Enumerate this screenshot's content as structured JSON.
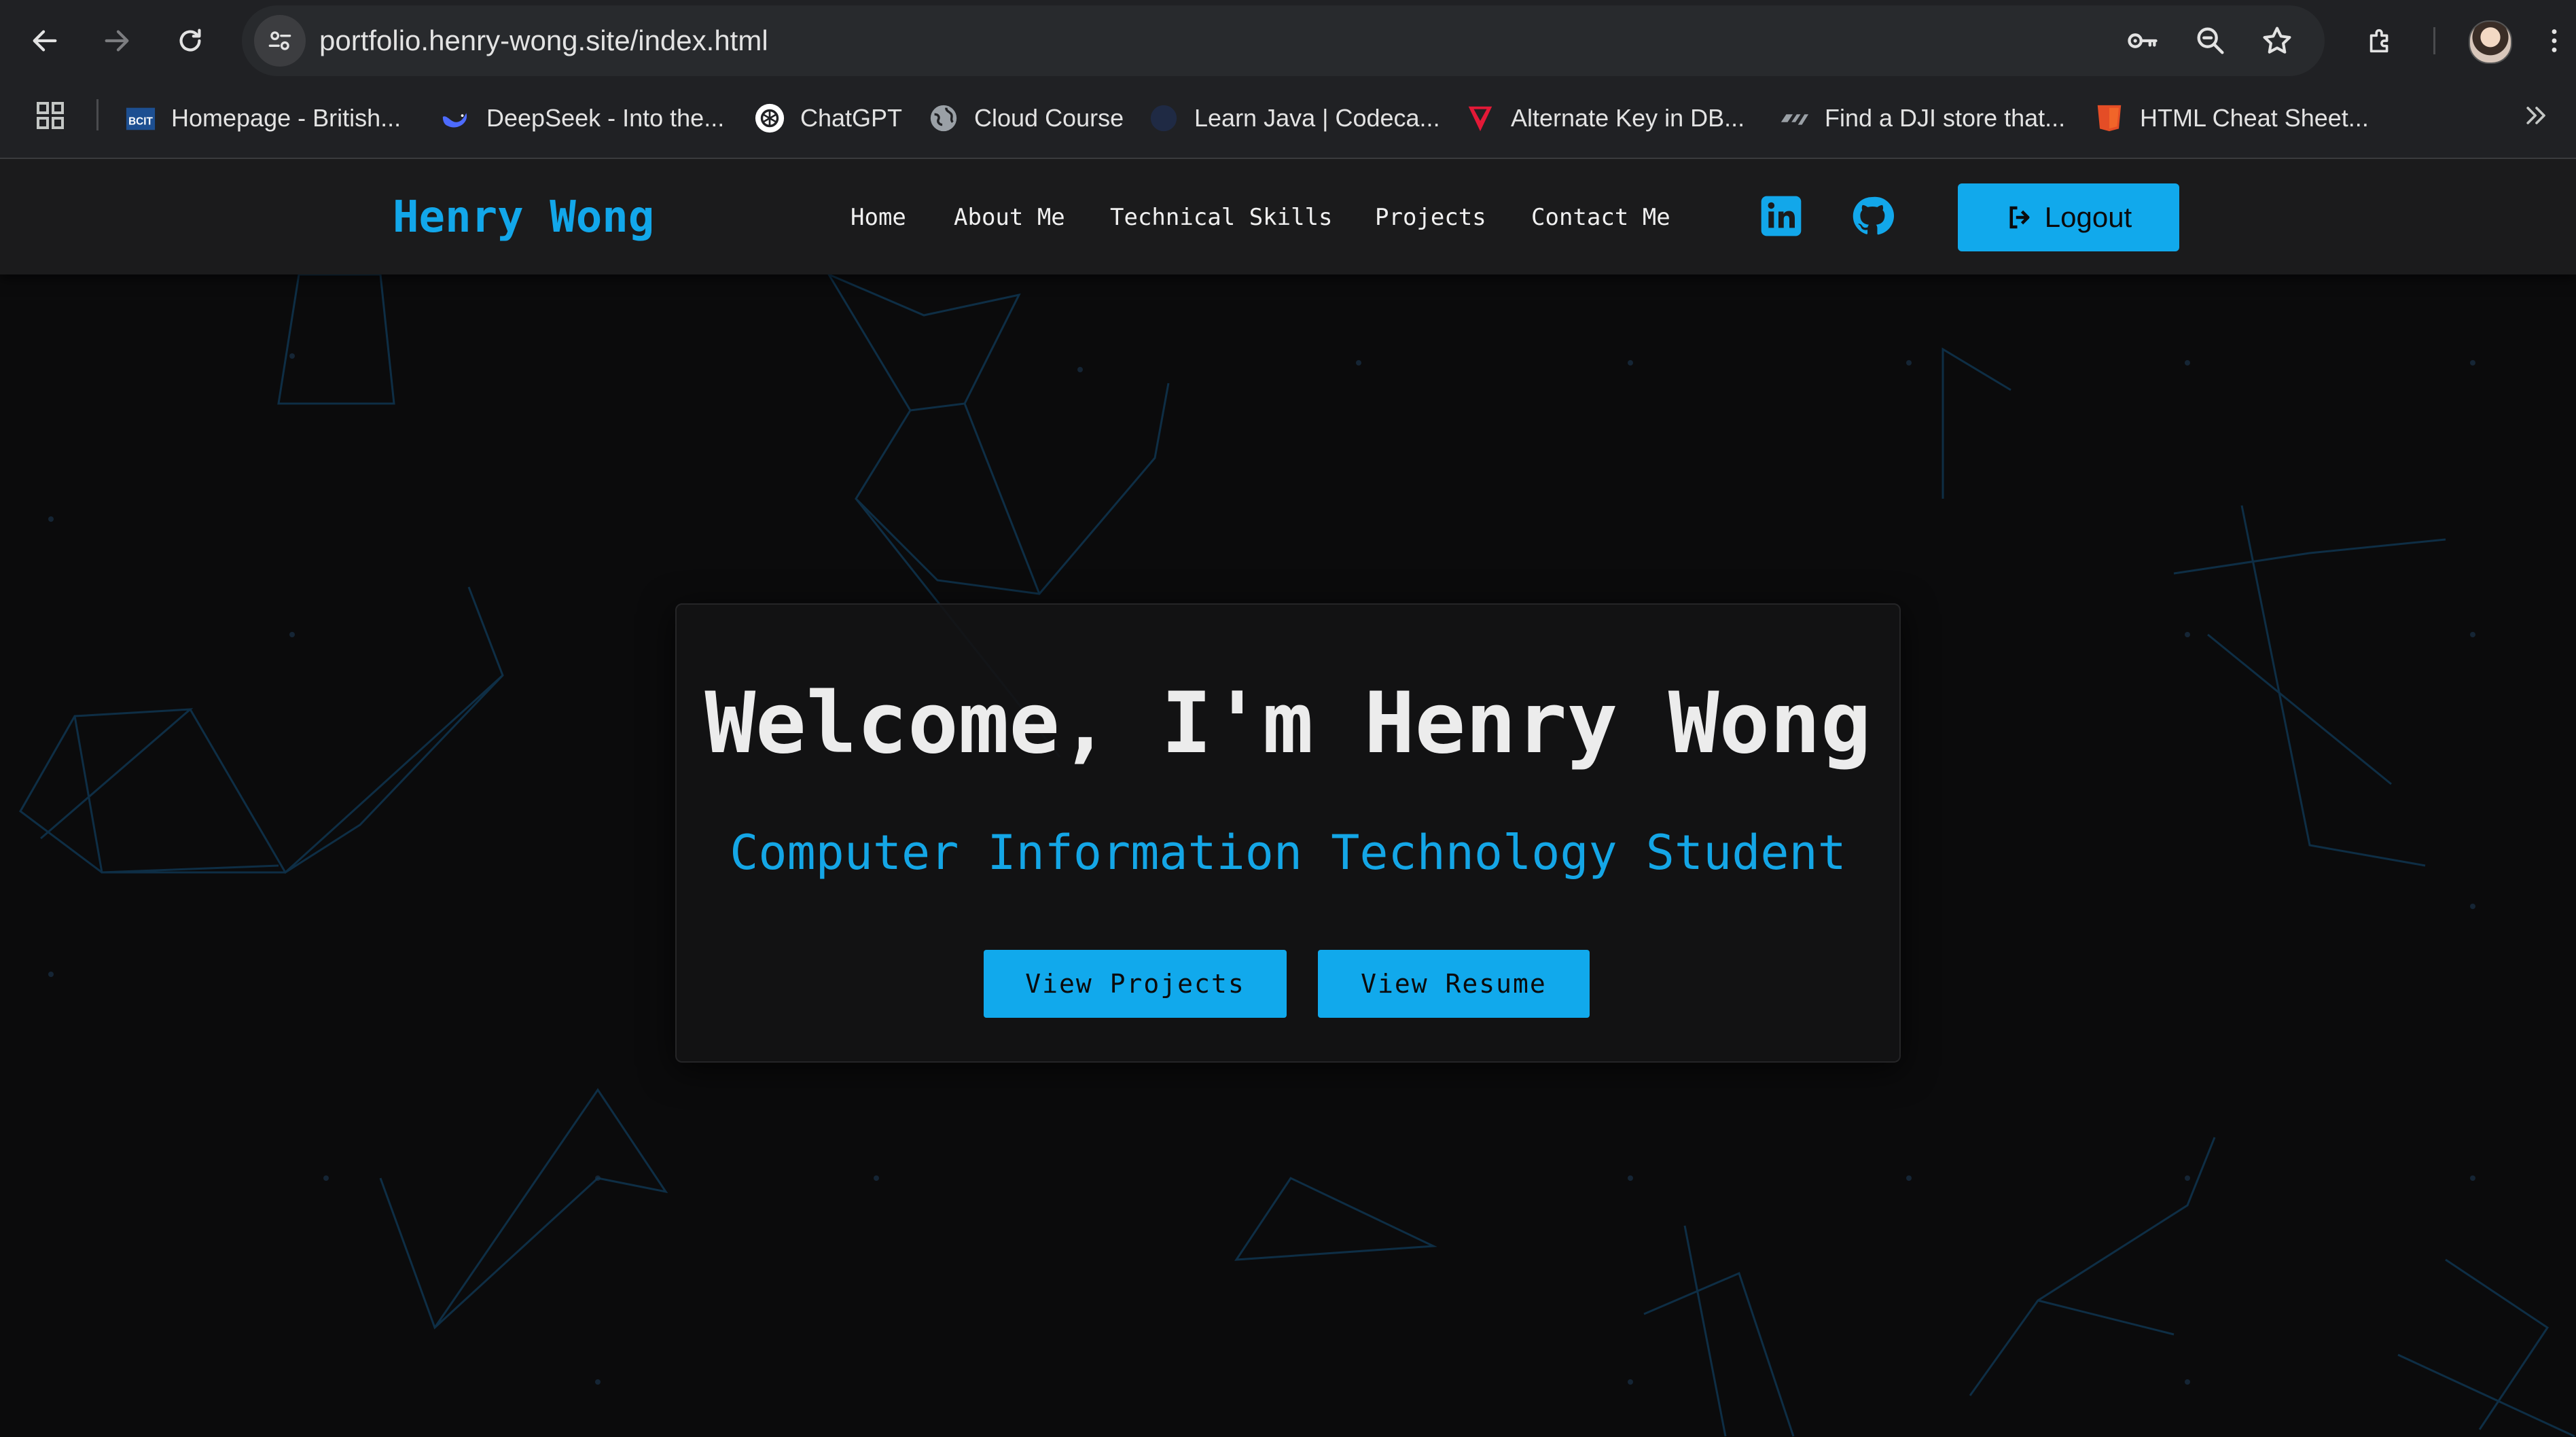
{
  "browser": {
    "url": "portfolio.henry-wong.site/index.html",
    "bookmarks": [
      {
        "label": "Homepage - British...",
        "icon": "bcit-icon"
      },
      {
        "label": "DeepSeek - Into the...",
        "icon": "deepseek-icon"
      },
      {
        "label": "ChatGPT",
        "icon": "chatgpt-icon"
      },
      {
        "label": "Cloud Course",
        "icon": "globe-icon"
      },
      {
        "label": "Learn Java | Codeca...",
        "icon": "codecademy-icon"
      },
      {
        "label": "Alternate Key in DB...",
        "icon": "tesla-icon"
      },
      {
        "label": "Find a DJI store that...",
        "icon": "dji-icon"
      },
      {
        "label": "HTML Cheat Sheet...",
        "icon": "html5-icon"
      }
    ],
    "bcit_badge": "BCIT"
  },
  "nav": {
    "brand": "Henry Wong",
    "links": [
      "Home",
      "About Me",
      "Technical Skills",
      "Projects",
      "Contact Me"
    ],
    "logout": "Logout"
  },
  "hero": {
    "title": "Welcome, I'm Henry Wong",
    "subtitle": "Computer Information Technology Student",
    "buttons": [
      "View Projects",
      "View Resume"
    ]
  },
  "colors": {
    "accent": "#11a9ec",
    "background": "#0b0b0c",
    "navbar": "#1b1b1c",
    "chrome": "#202124"
  }
}
